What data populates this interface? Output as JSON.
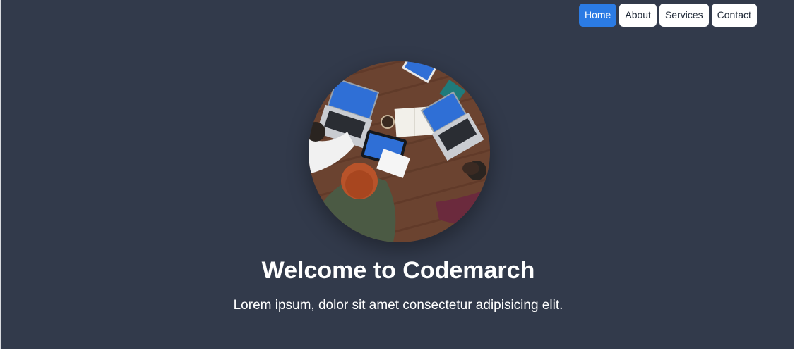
{
  "nav": {
    "items": [
      {
        "label": "Home",
        "active": true
      },
      {
        "label": "About",
        "active": false
      },
      {
        "label": "Services",
        "active": false
      },
      {
        "label": "Contact",
        "active": false
      }
    ]
  },
  "hero": {
    "title": "Welcome to Codemarch",
    "subtitle": "Lorem ipsum, dolor sit amet consectetur adipisicing elit.",
    "image": "team-meeting-overhead-photo"
  },
  "colors": {
    "background": "#323a4b",
    "accent": "#2b7be4",
    "text": "#ffffff"
  }
}
